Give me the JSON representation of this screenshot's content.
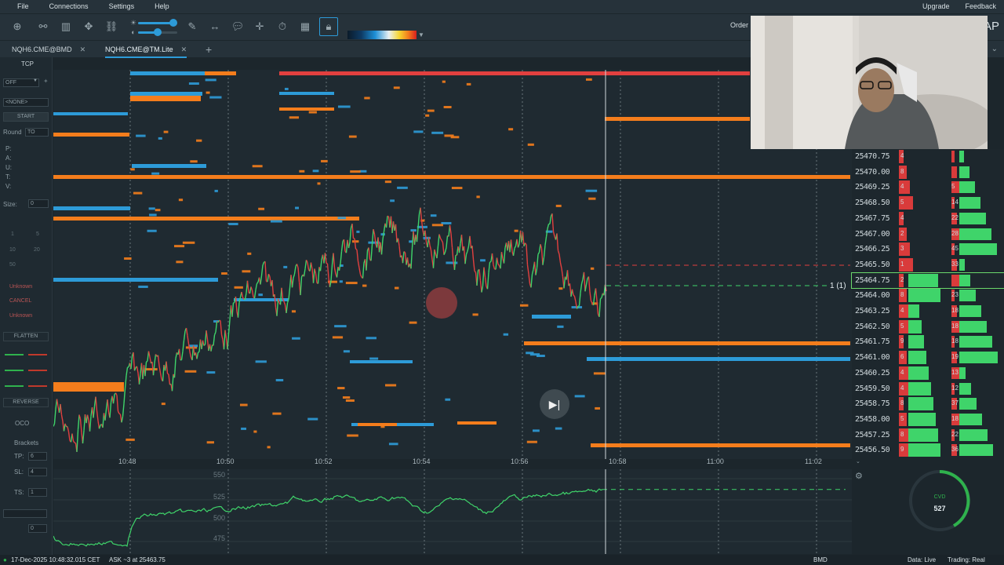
{
  "menu": {
    "file": "File",
    "connections": "Connections",
    "settings": "Settings",
    "help": "Help",
    "upgrade": "Upgrade",
    "feedback": "Feedback"
  },
  "toolbar": {
    "order_label": "Order",
    "brand_fragment": "AP",
    "heatmap_colors": [
      "#0b1b2a",
      "#1d8fd6",
      "#e9f0f3",
      "#f7d530",
      "#f47d1c",
      "#d81f1f"
    ]
  },
  "tabs": [
    {
      "label": "NQH6.CME@BMD",
      "active": false
    },
    {
      "label": "NQH6.CME@TM.Lite",
      "active": true
    }
  ],
  "left_panel": {
    "title": "TCP",
    "off": "OFF",
    "none": "<NONE>",
    "start": "START",
    "round_label": "Round",
    "round_value": "TO",
    "plauv": [
      "P:",
      "A:",
      "U:",
      "T:",
      "V:"
    ],
    "size_label": "Size:",
    "size_value": "0",
    "quick_sizes": [
      "1",
      "5",
      "10",
      "20",
      "50"
    ],
    "unknown1": "Unknown",
    "cancel": "CANCEL",
    "unknown2": "Unknown",
    "flatten": "FLATTEN",
    "reverse": "REVERSE",
    "oco": "OCO",
    "brackets": "Brackets",
    "tp_label": "TP:",
    "tp_value": "6",
    "sl_label": "SL:",
    "sl_value": "4",
    "ts_label": "TS:",
    "ts_value": "1",
    "bottom_value": "0"
  },
  "chart": {
    "time_labels": [
      "10:48",
      "10:50",
      "10:52",
      "10:54",
      "10:56",
      "10:58",
      "11:00",
      "11:02"
    ],
    "position_label": "1 (1)",
    "colors": {
      "bid": "#2d9bd8",
      "ask": "#f47d1c",
      "up": "#3fd46a",
      "down": "#e2403f"
    }
  },
  "ladder": [
    {
      "price": "25470.75",
      "bid": "4",
      "ask": ""
    },
    {
      "price": "25470.00",
      "bid": "8",
      "ask": ""
    },
    {
      "price": "25469.25",
      "bid": "4",
      "ask": "5"
    },
    {
      "price": "25468.50",
      "bid": "5",
      "ask": "14"
    },
    {
      "price": "25467.75",
      "bid": "4",
      "ask": "22"
    },
    {
      "price": "25467.00",
      "bid": "2",
      "ask": "28"
    },
    {
      "price": "25466.25",
      "bid": "3",
      "ask": "45"
    },
    {
      "price": "25465.50",
      "bid": "1",
      "ask": "33"
    },
    {
      "price": "25464.75",
      "bid": "2",
      "ask": ""
    },
    {
      "price": "25464.00",
      "bid": "8",
      "ask": "23"
    },
    {
      "price": "25463.25",
      "bid": "4",
      "ask": "18"
    },
    {
      "price": "25462.50",
      "bid": "5",
      "ask": "18"
    },
    {
      "price": "25461.75",
      "bid": "9",
      "ask": "18"
    },
    {
      "price": "25461.00",
      "bid": "6",
      "ask": "19"
    },
    {
      "price": "25460.25",
      "bid": "4",
      "ask": "13"
    },
    {
      "price": "25459.50",
      "bid": "4",
      "ask": "12"
    },
    {
      "price": "25458.75",
      "bid": "8",
      "ask": "37"
    },
    {
      "price": "25458.00",
      "bid": "5",
      "ask": "18"
    },
    {
      "price": "25457.25",
      "bid": "8",
      "ask": "22"
    },
    {
      "price": "25456.50",
      "bid": "9",
      "ask": "36"
    }
  ],
  "cvd": {
    "title": "CVD",
    "value": "527",
    "axis": [
      "550",
      "525",
      "500",
      "475"
    ]
  },
  "status": {
    "timestamp": "17-Dec-2025 10:48:32.015 CET",
    "ask_info": "ASK ~3 at 25463.75",
    "feed": "BMD",
    "data": "Data: Live",
    "trading": "Trading: Real"
  }
}
